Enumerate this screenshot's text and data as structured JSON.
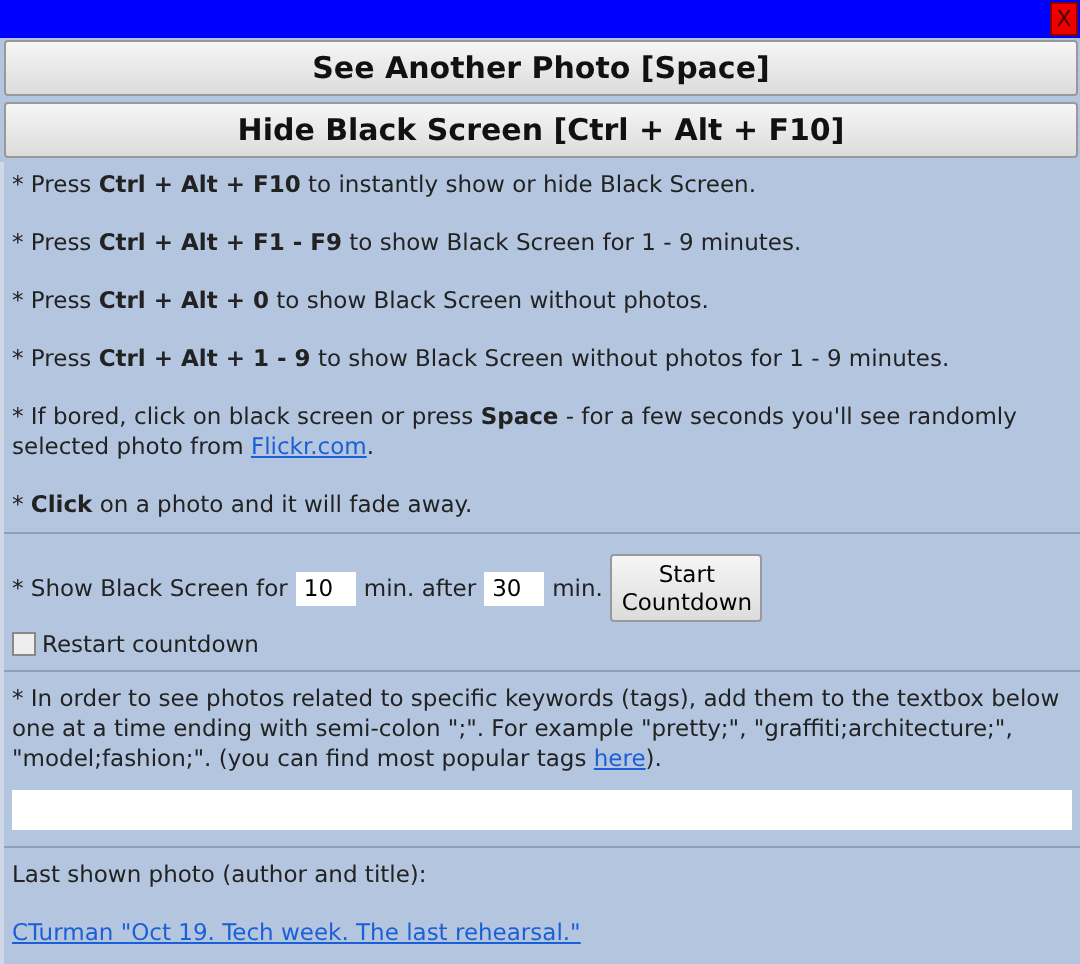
{
  "window": {
    "close": "X"
  },
  "buttons": [
    "See Another Photo [Space]",
    "Hide Black Screen [Ctrl + Alt + F10]"
  ],
  "hints": [
    {
      "text": "* Press **Ctrl + Alt + F10** to instantly show or hide Black Screen."
    },
    {
      "text": "* Press **Ctrl + Alt + F1 - F9** to show Black Screen for 1 - 9 minutes."
    },
    {
      "text": "* Press **Ctrl + Alt + 0** to show Black Screen without photos."
    },
    {
      "text": "* Press **Ctrl + Alt + 1 - 9** to show Black Screen without photos for 1 - 9 minutes."
    },
    {
      "text": "* If bored, click on black screen or press **Space** - for a few seconds you'll see randomly selected photo from ",
      "link": "Flickr.com",
      "after": "."
    },
    {
      "text": "* **Click** on a photo and it will fade away."
    }
  ],
  "timer": {
    "label": "* Show Black Screen for",
    "duration": "10",
    "middle": "min. after",
    "delay": "30",
    "unit": "min.",
    "button": "Start Countdown"
  },
  "restart": {
    "label": "Restart countdown",
    "checked": false
  },
  "tags": {
    "text": "* In order to see photos related to specific keywords (tags), add them to the textbox below one at a time ending with semi-colon \";\". For example \"pretty;\", \"graffiti;architecture;\", \"model;fashion;\". (you can find most popular tags ",
    "link": "here",
    "after": ")."
  },
  "last_photo": {
    "label": "Last shown photo (author and title):",
    "link": "CTurman \"Oct 19.  Tech week.  The last rehearsal.\""
  }
}
